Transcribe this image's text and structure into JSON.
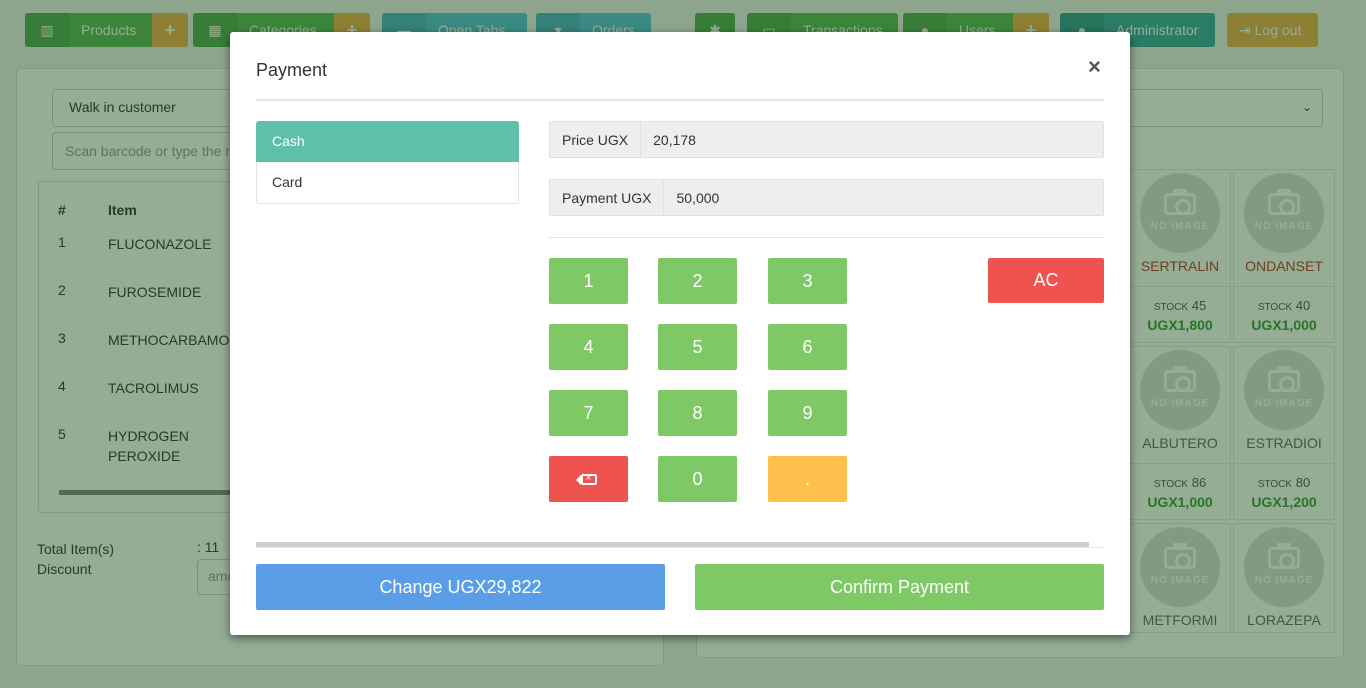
{
  "topbar": {
    "products": "Products",
    "categories": "Categories",
    "open_tabs": "Open Tabs",
    "orders": "Orders",
    "transactions": "Transactions",
    "users": "Users",
    "administrator": "Administrator",
    "logout": "Log out",
    "plus": "+"
  },
  "left": {
    "customer": "Walk in customer",
    "barcode_placeholder": "Scan barcode or type the n",
    "col_num": "#",
    "col_item": "Item",
    "rows": [
      {
        "num": "1",
        "item": "FLUCONAZOLE"
      },
      {
        "num": "2",
        "item": "FUROSEMIDE"
      },
      {
        "num": "3",
        "item": "METHOCARBAMOL"
      },
      {
        "num": "4",
        "item": "TACROLIMUS"
      },
      {
        "num": "5",
        "item": "HYDROGEN PEROXIDE"
      }
    ],
    "total_items_label": "Total Item(s)",
    "total_items_value": ": 11",
    "discount_label": "Discount",
    "discount_placeholder": "amo"
  },
  "products": [
    {
      "name": "SERTRALIN",
      "stock": "45",
      "price": "UGX1,800"
    },
    {
      "name": "ONDANSET",
      "stock": "40",
      "price": "UGX1,000"
    },
    {
      "name": "ALBUTERO",
      "stock": "86",
      "price": "UGX1,000"
    },
    {
      "name": "ESTRADIOI",
      "stock": "80",
      "price": "UGX1,200"
    },
    {
      "name": "METFORMI",
      "stock": "",
      "price": ""
    },
    {
      "name": "LORAZEPA",
      "stock": "",
      "price": ""
    }
  ],
  "product_card": {
    "no_image": "NO IMAGE",
    "stock_caption": "STOCK"
  },
  "modal": {
    "title": "Payment",
    "close": "×",
    "methods": [
      "Cash",
      "Card"
    ],
    "price_label": "Price UGX",
    "price_value": "20,178",
    "payment_label": "Payment UGX",
    "payment_value": "50,000",
    "keys": [
      "1",
      "2",
      "3",
      "4",
      "5",
      "6",
      "7",
      "8",
      "9",
      "0",
      "."
    ],
    "ac": "AC",
    "backspace_glyph": "×",
    "change": "Change UGX29,822",
    "confirm": "Confirm Payment"
  }
}
